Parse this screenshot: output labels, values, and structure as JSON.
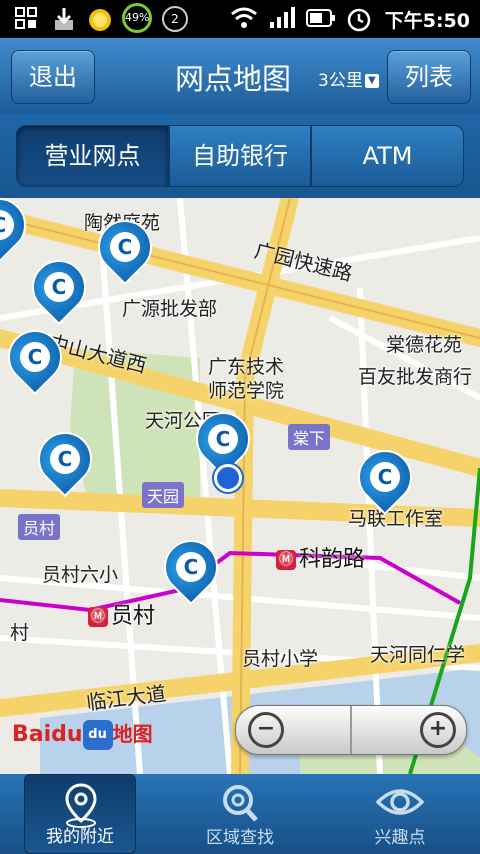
{
  "status_bar": {
    "battery_percent": "49%",
    "notification_count": "2",
    "time": "下午5:50"
  },
  "header": {
    "exit_label": "退出",
    "title": "网点地图",
    "range": "3公里",
    "list_label": "列表"
  },
  "segments": [
    {
      "label": "营业网点"
    },
    {
      "label": "自助银行"
    },
    {
      "label": "ATM"
    }
  ],
  "map": {
    "pois": [
      "陶然庭苑",
      "广源批发部",
      "广东技术",
      "师范学院",
      "天河公园",
      "棠德花苑",
      "百友批发商行",
      "马联工作室",
      "员村六小",
      "员村小学",
      "天河同仁学",
      "村"
    ],
    "roads": [
      "广园快速路",
      "中山大道西",
      "临江大道"
    ],
    "stations": [
      "棠下",
      "天园",
      "员村"
    ],
    "metro": [
      "科韵路",
      "员村"
    ],
    "logo": {
      "brand": "Baidu",
      "paw": "du",
      "suffix": "地图"
    }
  },
  "zoom": {
    "out": "−",
    "in": "+"
  },
  "tabs": [
    {
      "label": "我的附近"
    },
    {
      "label": "区域查找"
    },
    {
      "label": "兴趣点"
    }
  ]
}
